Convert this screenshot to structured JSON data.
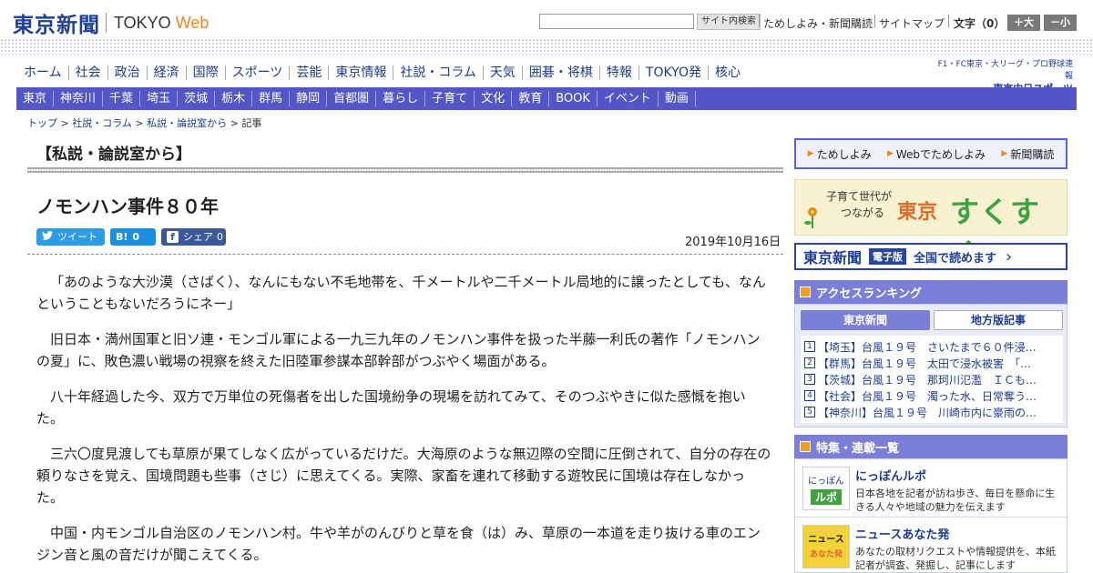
{
  "header": {
    "logo_kanji": "東京新聞",
    "logo_tokyo": "TOKYO",
    "logo_web": "Web",
    "search_button": "サイト内検索",
    "util_links": [
      "ためしよみ・新聞購読",
      "サイトマップ"
    ],
    "font_size_label": "文字（0）",
    "font_plus": "＋大",
    "font_minus": "－小"
  },
  "nav_primary": [
    "ホーム",
    "社会",
    "政治",
    "経済",
    "国際",
    "スポーツ",
    "芸能",
    "東京情報",
    "社説・コラム",
    "天気",
    "囲碁・将棋",
    "特報",
    "TOKYO発",
    "核心"
  ],
  "nav_secondary": [
    "東京",
    "神奈川",
    "千葉",
    "埼玉",
    "茨城",
    "栃木",
    "群馬",
    "静岡",
    "首都圏",
    "暮らし",
    "子育て",
    "文化",
    "教育",
    "BOOK",
    "イベント",
    "動画"
  ],
  "chunichi": {
    "top": "F1・FC東京・大リーグ・プロ野球速報",
    "bottom": "東京中日スポーツ"
  },
  "breadcrumb": [
    "トップ",
    "社説・コラム",
    "私説・論説室から",
    "記事"
  ],
  "article": {
    "section": "【私説・論説室から】",
    "title": "ノモンハン事件８０年",
    "date": "2019年10月16日",
    "share": {
      "tweet": "ツイート",
      "hatena_count": "0",
      "facebook": "シェア",
      "facebook_count": "0"
    },
    "paragraphs": [
      "「あのような大沙漠（さばく）、なんにもない不毛地帯を、千メートルや二千メートル局地的に譲ったとしても、なんということもないだろうにネー」",
      "旧日本・満州国軍と旧ソ連・モンゴル軍による一九三九年のノモンハン事件を扱った半藤一利氏の著作「ノモンハンの夏」に、敗色濃い戦場の視察を終えた旧陸軍参謀本部幹部がつぶやく場面がある。",
      "八十年経過した今、双方で万単位の死傷者を出した国境紛争の現場を訪れてみて、そのつぶやきに似た感慨を抱いた。",
      "三六〇度見渡しても草原が果てしなく広がっているだけだ。大海原のような無辺際の空間に圧倒されて、自分の存在の頼りなさを覚え、国境問題も些事（さじ）に思えてくる。実際、家畜を連れて移動する遊牧民に国境は存在しなかった。",
      "中国・内モンゴル自治区のノモンハン村。牛や羊がのんびりと草を食（は）み、草原の一本道を走り抜ける車のエンジン音と風の音だけが聞こえてくる。"
    ]
  },
  "sidebar": {
    "links": [
      "ためしよみ",
      "Webでためしよみ",
      "新聞購読"
    ],
    "sukusuku": {
      "line1": "子育て世代が",
      "line2": "つながる",
      "tokyo": "東京",
      "main": "すくすく"
    },
    "eban": {
      "logo": "東京新聞",
      "tag": "電子版",
      "text": "全国で読めます"
    },
    "ranking": {
      "title": "アクセスランキング",
      "tab_active": "東京新聞",
      "tab_inactive": "地方版記事",
      "items": [
        "【埼玉】台風１９号　さいたまで６０件浸…",
        "【群馬】台風１９号　太田で浸水被害　「…",
        "【茨城】台風１９号　那珂川氾濫　ＩＣも…",
        "【社会】台風１９号　濁った水、日常奪う…",
        "【神奈川】台風１９号　川崎市内に豪雨の…"
      ]
    },
    "features": {
      "title": "特集・連載一覧",
      "items": [
        {
          "thumb_top": "にっぽん",
          "thumb_bottom": "ルポ",
          "title": "にっぽんルポ",
          "desc": "日本各地を記者が訪ね歩き、毎日を懸命に生きる人々や地域の魅力を伝えます"
        },
        {
          "thumb_top": "ニュース",
          "thumb_bottom": "あなた発",
          "title": "ニュースあなた発",
          "desc": "あなたの取材リクエストや情報提供を、本紙記者が調査、発掘し、記事にします"
        }
      ]
    }
  },
  "colors": {
    "brand_blue": "#1f3f99",
    "nav_purple": "#5256c7",
    "accent_orange": "#e8891c"
  }
}
